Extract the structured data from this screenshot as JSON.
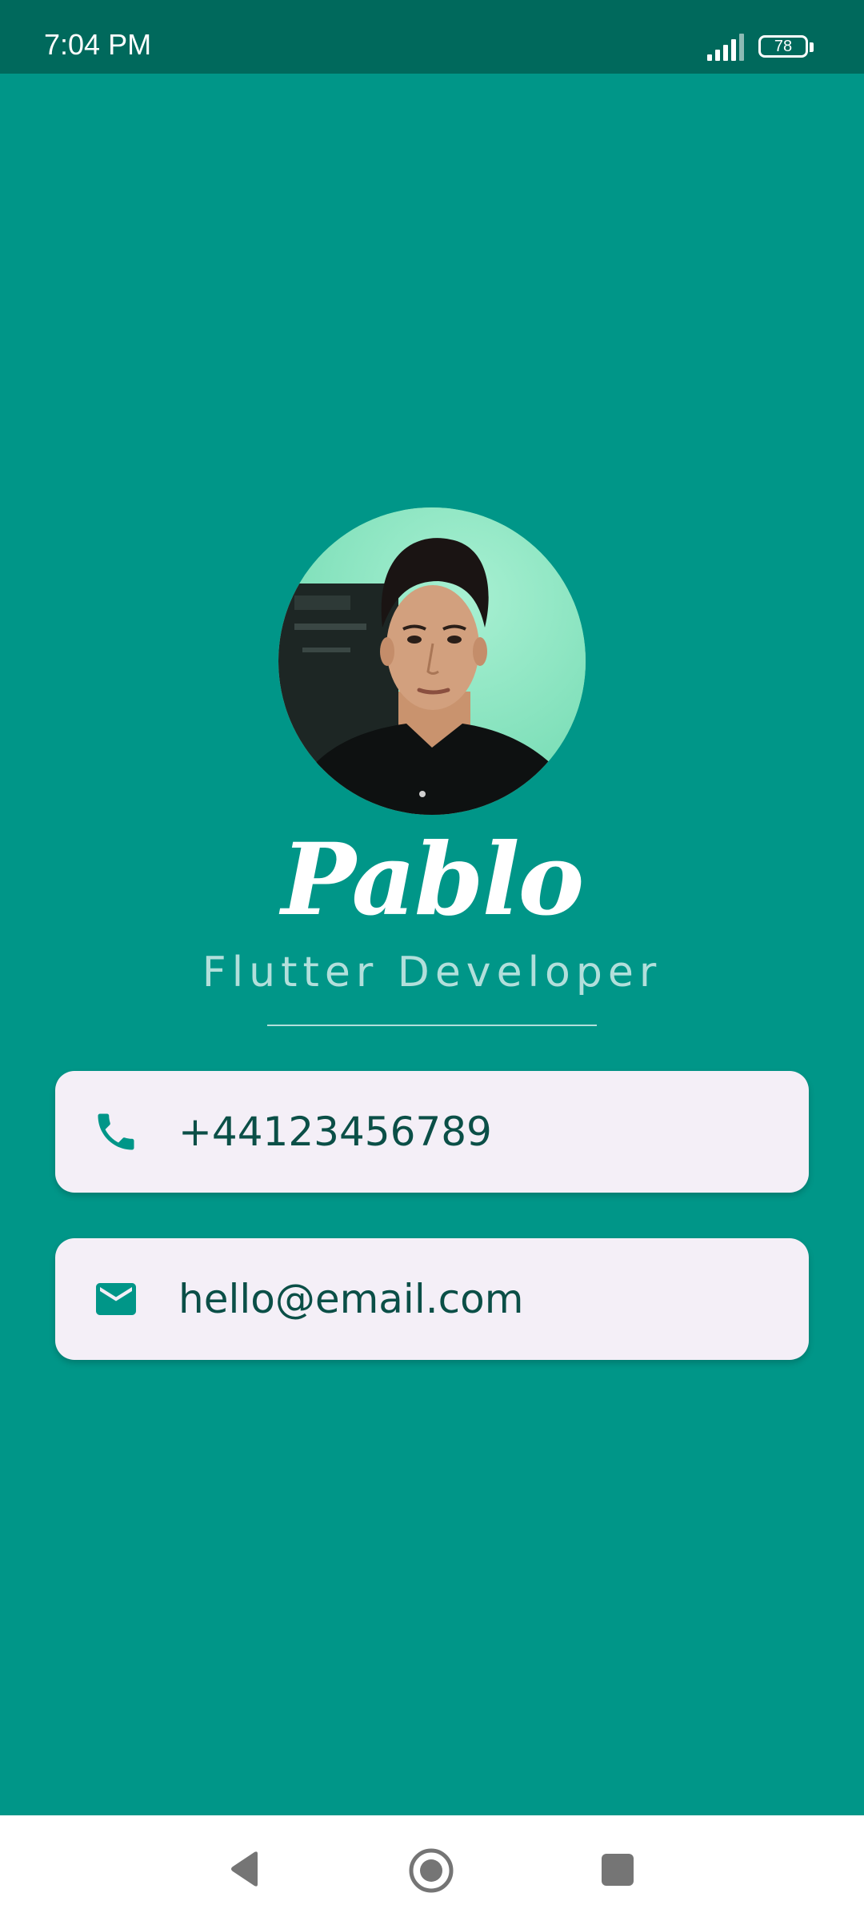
{
  "status_bar": {
    "time": "7:04 PM",
    "battery_level": "78",
    "signal_icon": "signal-bars-icon",
    "battery_icon": "battery-icon"
  },
  "profile": {
    "name": "Pablo",
    "title": "Flutter Developer"
  },
  "contacts": [
    {
      "icon": "phone-icon",
      "value": "+44123456789"
    },
    {
      "icon": "email-icon",
      "value": "hello@email.com"
    }
  ],
  "nav": {
    "back_icon": "back-triangle-icon",
    "home_icon": "home-circle-icon",
    "recents_icon": "recents-square-icon"
  },
  "colors": {
    "background": "#009688",
    "status_bar": "#00695C",
    "card_background": "#F4EFF7",
    "card_text": "#0B4F47",
    "icon": "#009688",
    "subtitle": "#B2DFDB"
  }
}
